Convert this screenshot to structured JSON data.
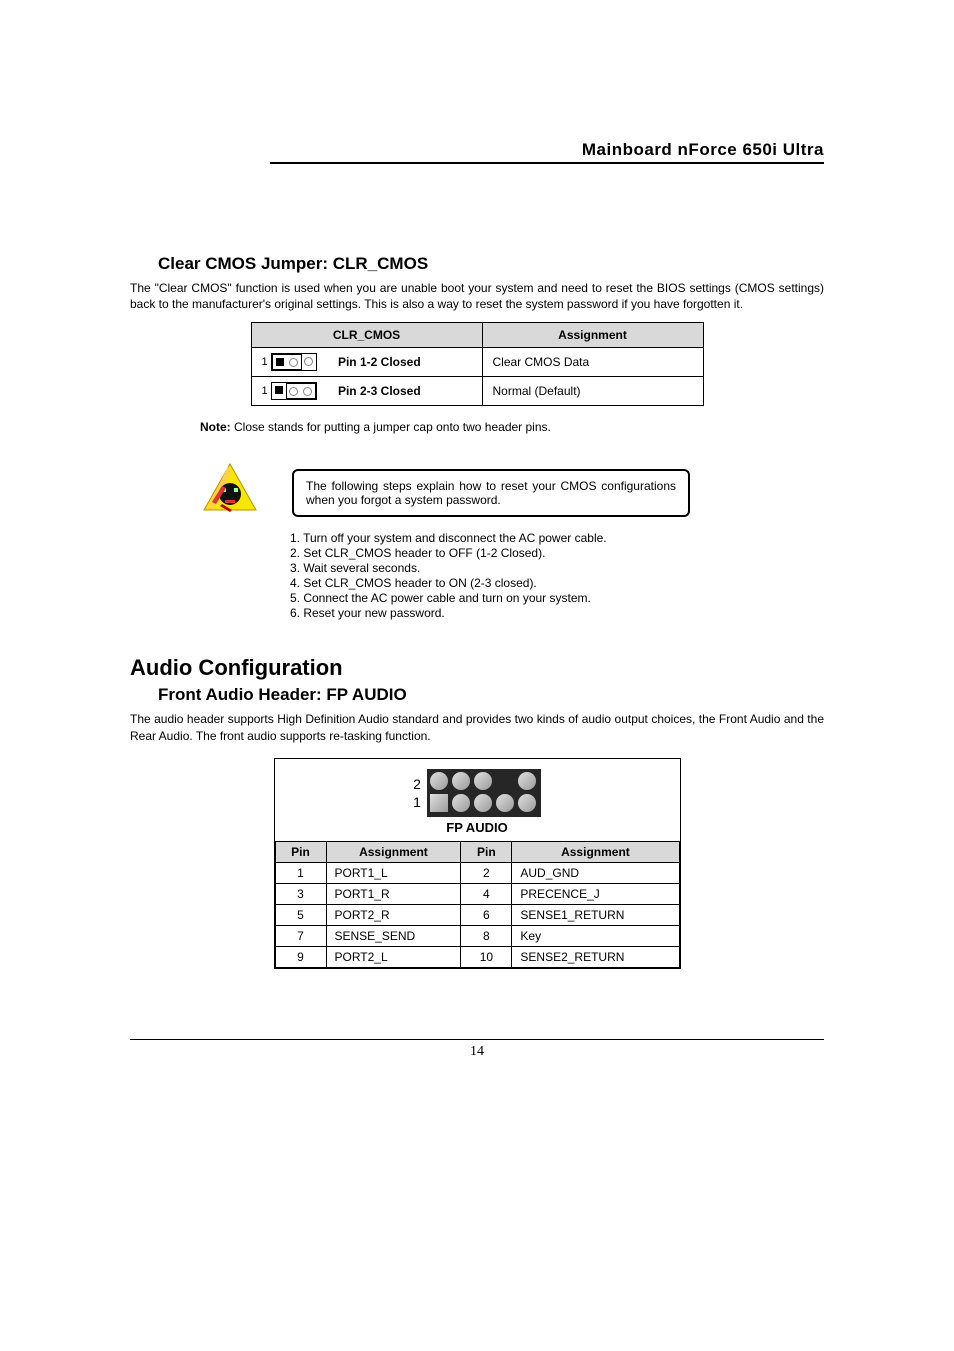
{
  "header": {
    "title": "Mainboard nForce 650i Ultra"
  },
  "clr": {
    "heading": "Clear CMOS Jumper: CLR_CMOS",
    "intro": "The \"Clear CMOS\" function is used when you are unable boot your system and need to reset the BIOS settings (CMOS settings) back to the manufacturer's original settings. This is also a way to reset the system password if you have forgotten it.",
    "th1": "CLR_CMOS",
    "th2": "Assignment",
    "row1_label": "Pin 1-2 Closed",
    "row1_assign": "Clear CMOS Data",
    "row2_label": "Pin 2-3 Closed",
    "row2_assign": "Normal (Default)",
    "pin_one": "1",
    "note_bold": "Note:",
    "note_text": " Close stands for putting a jumper cap onto two header pins.",
    "warn": "The following steps explain how to reset your CMOS configurations when you forgot a system password.",
    "steps": [
      "1. Turn off your system and disconnect the AC power cable.",
      "2. Set CLR_CMOS header to OFF (1-2 Closed).",
      "3. Wait several seconds.",
      "4. Set CLR_CMOS header to ON (2-3 closed).",
      "5. Connect the AC power cable and turn on your system.",
      "6. Reset your new password."
    ]
  },
  "audio": {
    "h1": "Audio Configuration",
    "h2": "Front Audio Header: FP AUDIO",
    "intro": "The audio header supports High Definition Audio standard and provides two kinds of audio output choices, the Front Audio and the Rear Audio. The front audio supports re-tasking function.",
    "diagram_label": "FP AUDIO",
    "pin_top": "2",
    "pin_bot": "1",
    "th_pin": "Pin",
    "th_assign": "Assignment",
    "rows": [
      {
        "p1": "1",
        "a1": "PORT1_L",
        "p2": "2",
        "a2": "AUD_GND"
      },
      {
        "p1": "3",
        "a1": "PORT1_R",
        "p2": "4",
        "a2": "PRECENCE_J"
      },
      {
        "p1": "5",
        "a1": "PORT2_R",
        "p2": "6",
        "a2": "SENSE1_RETURN"
      },
      {
        "p1": "7",
        "a1": "SENSE_SEND",
        "p2": "8",
        "a2": "Key"
      },
      {
        "p1": "9",
        "a1": "PORT2_L",
        "p2": "10",
        "a2": "SENSE2_RETURN"
      }
    ]
  },
  "footer": {
    "page": "14"
  }
}
